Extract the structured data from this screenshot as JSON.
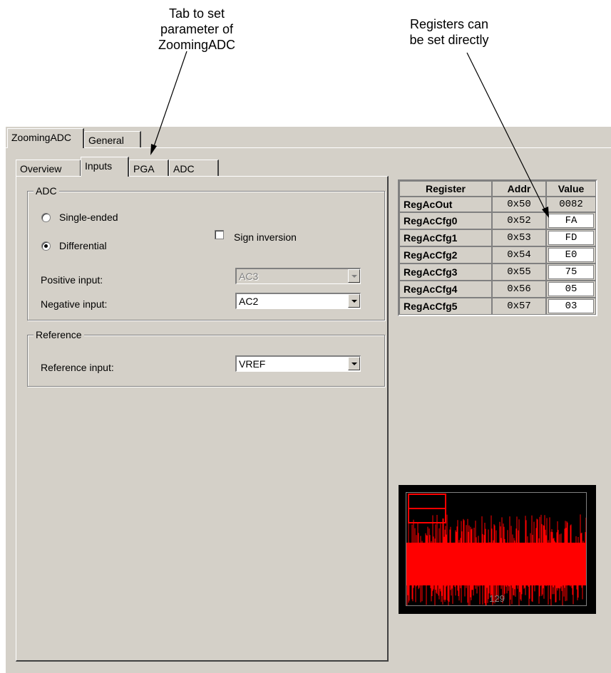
{
  "annotations": {
    "tab_note": [
      "Tab to set",
      "parameter of",
      "ZoomingADC"
    ],
    "register_note": [
      "Registers can",
      "be set directly"
    ]
  },
  "outer_tabs": [
    "ZoomingADC",
    "General"
  ],
  "inner_tabs": [
    "Overview",
    "Inputs",
    "PGA",
    "ADC"
  ],
  "active_inner_tab": "Inputs",
  "adc_group": {
    "title": "ADC",
    "single_ended": "Single-ended",
    "differential": "Differential",
    "selected_mode": "Differential",
    "sign_inversion": "Sign inversion",
    "sign_inversion_checked": false,
    "positive_input_label": "Positive input:",
    "positive_input_value": "AC3",
    "negative_input_label": "Negative input:",
    "negative_input_value": "AC2"
  },
  "reference_group": {
    "title": "Reference",
    "reference_input_label": "Reference input:",
    "reference_input_value": "VREF"
  },
  "registers": {
    "headers": [
      "Register",
      "Addr",
      "Value"
    ],
    "rows": [
      {
        "name": "RegAcOut",
        "addr": "0x50",
        "value": "0082"
      },
      {
        "name": "RegAcCfg0",
        "addr": "0x52",
        "value": "FA"
      },
      {
        "name": "RegAcCfg1",
        "addr": "0x53",
        "value": "FD"
      },
      {
        "name": "RegAcCfg2",
        "addr": "0x54",
        "value": "E0"
      },
      {
        "name": "RegAcCfg3",
        "addr": "0x55",
        "value": "75"
      },
      {
        "name": "RegAcCfg4",
        "addr": "0x56",
        "value": "05"
      },
      {
        "name": "RegAcCfg5",
        "addr": "0x57",
        "value": "03"
      }
    ]
  },
  "plot": {
    "label": "129",
    "signal_color": "#ff0000",
    "background_color": "#000000"
  }
}
